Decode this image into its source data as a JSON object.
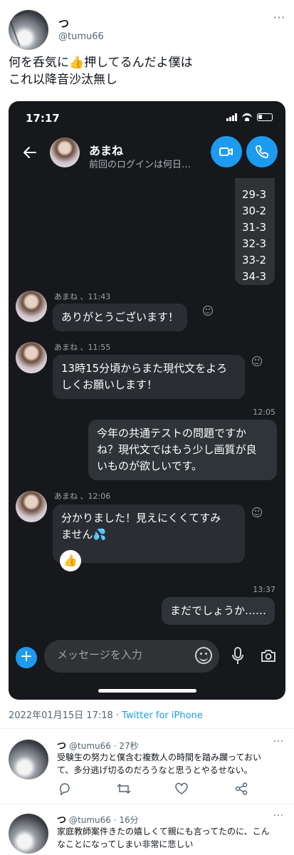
{
  "tweet": {
    "author_name": "つ",
    "author_handle": "@tumu66",
    "more_label": "···",
    "text_lines": [
      "何を呑気に👍押してるんだよ僕は",
      "これ以降音沙汰無し"
    ],
    "date": "2022年01月15日 17:18",
    "separator": " · ",
    "source": "Twitter for iPhone"
  },
  "screenshot": {
    "status_time": "17:17",
    "chat_header": {
      "name": "あまね",
      "subtitle": "前回のログインは何日…"
    },
    "answer_list": [
      "29-3",
      "30-2",
      "31-3",
      "32-3",
      "33-2",
      "34-3"
    ],
    "messages": [
      {
        "meta": "あまね 、11:43",
        "lines": [
          "ありがとうございます！"
        ]
      },
      {
        "meta": "あまね 、11:55",
        "lines": [
          "13時15分頃からまた現代文をよろ",
          "しくお願いします！"
        ]
      },
      {
        "time": "12:05",
        "lines": [
          "今年の共通テストの問題ですか",
          "ね？現代文ではもう少し画質が良",
          "いものが欲しいです。"
        ]
      },
      {
        "meta": "あまね 、12:06",
        "lines": [
          "分かりました！見えにくくてすみ",
          "ません💦"
        ],
        "reaction": "👍"
      },
      {
        "time": "13:37",
        "lines": [
          "まだでしょうか……"
        ]
      }
    ],
    "composer": {
      "placeholder": "メッセージを入力",
      "plus_label": "+"
    }
  },
  "replies": [
    {
      "name": "つ",
      "handle": "@tumu66",
      "sep": " · ",
      "age": "27秒",
      "lines": [
        "受験生の努力と僕含む複数人の時間を踏み躙っておい",
        "て、多分逃げ切るのだろうなと思うとやるせない。"
      ]
    },
    {
      "name": "つ",
      "handle": "@tumu66",
      "sep": " · ",
      "age": "16分",
      "lines": [
        "家庭教師案件きたの嬉しくて親にも言ってたのに、こん",
        "なことになってしまい非常に悲しい"
      ]
    }
  ],
  "colors": {
    "accent": "#1d9bf0",
    "dark_bg": "#16181c",
    "bubble": "#2a2e33"
  }
}
